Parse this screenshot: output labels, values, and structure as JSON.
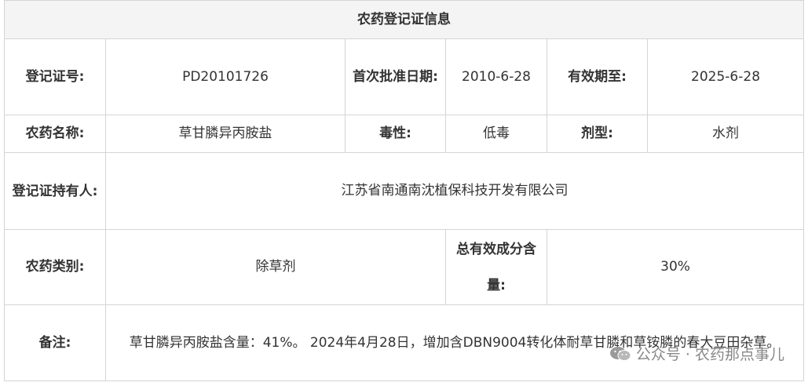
{
  "title": "农药登记证信息",
  "registration_no": {
    "label": "登记证号:",
    "value": "PD20101726"
  },
  "first_approval_date": {
    "label": "首次批准日期:",
    "value": "2010-6-28"
  },
  "valid_until": {
    "label": "有效期至:",
    "value": "2025-6-28"
  },
  "pesticide_name": {
    "label": "农药名称:",
    "value": "草甘膦异丙胺盐"
  },
  "toxicity": {
    "label": "毒性:",
    "value": "低毒"
  },
  "formulation": {
    "label": "剂型:",
    "value": "水剂"
  },
  "holder": {
    "label": "登记证持有人:",
    "value": "江苏省南通南沈植保科技开发有限公司"
  },
  "category": {
    "label": "农药类别:",
    "value": "除草剂"
  },
  "total_active_content": {
    "label": "总有效成分含量:",
    "value": "30%"
  },
  "remarks": {
    "label": "备注:",
    "value": "草甘膦异丙胺盐含量：41%。 2024年4月28日，增加含DBN9004转化体耐草甘膦和草铵膦的春大豆田杂草。"
  },
  "watermark": {
    "text": "公众号 · 农药那点事儿"
  }
}
